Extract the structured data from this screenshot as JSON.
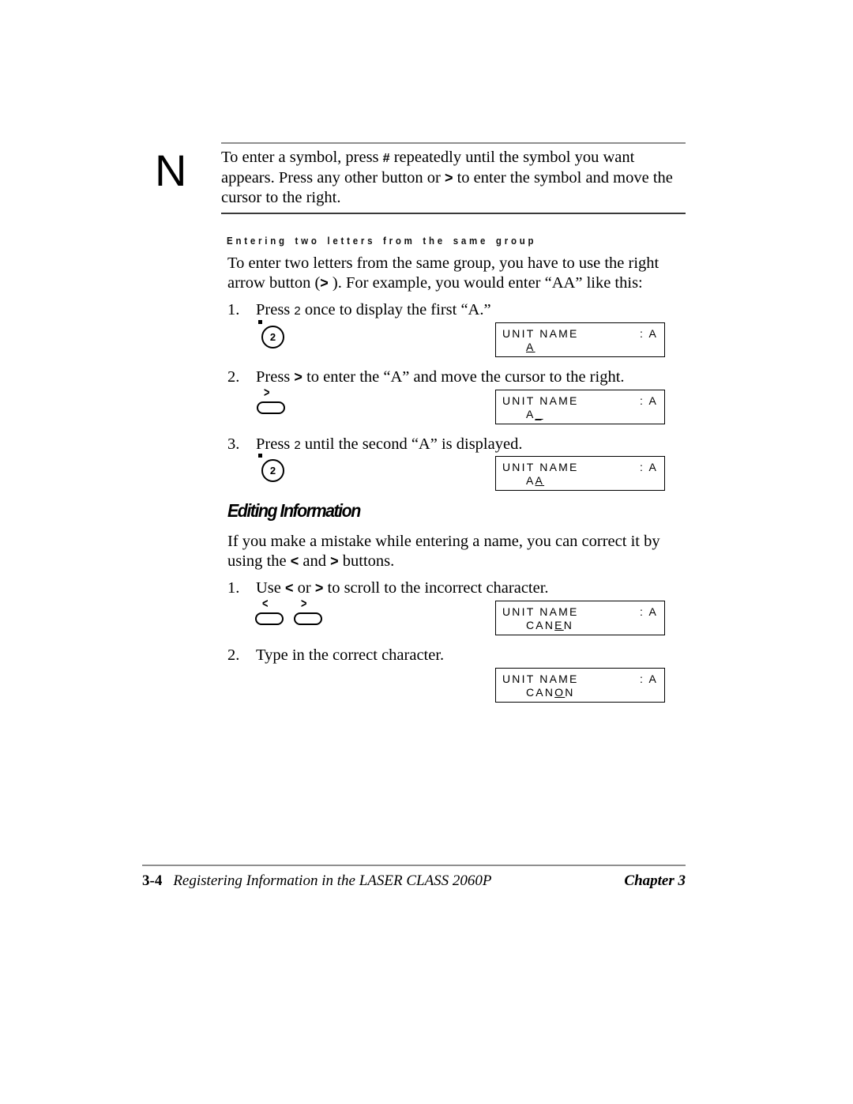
{
  "note": {
    "marker": "N",
    "line1_a": "To enter a symbol, press ",
    "line1_sym": "#",
    "line1_b": " repeatedly until the symbol you want appears.",
    "line2_a": "Press any other button or ",
    "line2_gt": ">",
    "line2_b": " to enter the symbol and move the cursor to",
    "line3": "the right."
  },
  "subheading": "Entering two letters from the same group",
  "intro": {
    "line1": "To enter two letters from the same group, you have to use the right arrow",
    "line2_a": "button (",
    "line2_gt": ">",
    "line2_b": " ). For example, you would enter “AA” like this:"
  },
  "steps_group": [
    {
      "num": "1.",
      "text_a": "Press ",
      "key": "2",
      "text_b": " once to display the first “A.”",
      "button_type": "keypad",
      "button_label": "2",
      "lcd": {
        "left": "UNIT NAME",
        "right": ": A",
        "value_pre": "",
        "value_cursor": "A",
        "value_post": ""
      }
    },
    {
      "num": "2.",
      "text_a": "Press ",
      "key": ">",
      "text_b": " to enter the “A” and move the cursor to the right.",
      "button_type": "arrow",
      "button_label": ">",
      "lcd": {
        "left": "UNIT NAME",
        "right": ": A",
        "value_pre": "A",
        "value_cursor": "_",
        "value_post": ""
      }
    },
    {
      "num": "3.",
      "text_a": "Press ",
      "key": "2",
      "text_b": " until the second “A” is displayed.",
      "button_type": "keypad",
      "button_label": "2",
      "lcd": {
        "left": "UNIT NAME",
        "right": ": A",
        "value_pre": "A",
        "value_cursor": "A",
        "value_post": ""
      }
    }
  ],
  "section_heading": "Editing Information",
  "editing": {
    "line1": "If you make a mistake while entering a name, you can correct it by using",
    "line2_a": "the ",
    "line2_lt": "<",
    "line2_mid": " and ",
    "line2_gt": ">",
    "line2_b": " buttons."
  },
  "steps_editing": [
    {
      "num": "1.",
      "text_a": "Use ",
      "lt": "<",
      "text_mid": " or ",
      "gt": ">",
      "text_b": " to scroll to the incorrect character.",
      "lcd": {
        "left": "UNIT NAME",
        "right": ": A",
        "value_pre": "CAN",
        "value_cursor": "E",
        "value_post": "N"
      }
    },
    {
      "num": "2.",
      "text_a": "Type in the correct character.",
      "lcd": {
        "left": "UNIT NAME",
        "right": ": A",
        "value_pre": "CAN",
        "value_cursor": "O",
        "value_post": "N"
      }
    }
  ],
  "arrow_buttons": {
    "left": "<",
    "right": ">"
  },
  "footer": {
    "page_number": "3-4",
    "title": "Registering Information in the LASER CLASS 2060P",
    "chapter": "Chapter 3"
  },
  "colors": {
    "rule_gray": "#8f8f8f",
    "ink": "#000000"
  }
}
